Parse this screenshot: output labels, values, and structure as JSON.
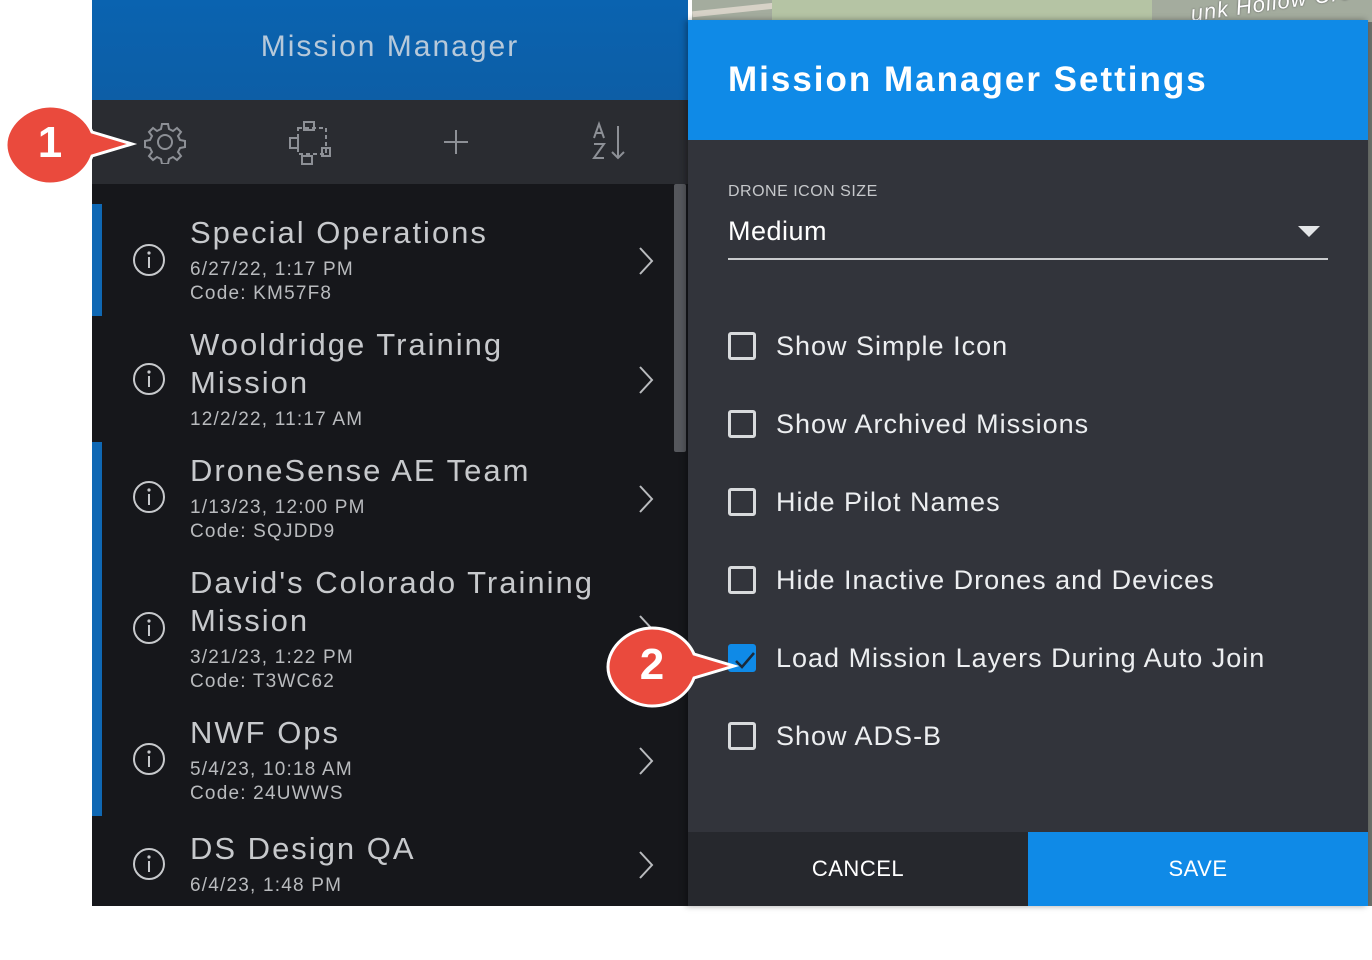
{
  "left_panel": {
    "title": "Mission Manager",
    "toolbar": {
      "settings_icon": "gear-icon",
      "layers_icon": "frame-select-icon",
      "add_icon": "plus-icon",
      "sort_icon": "sort-az-icon"
    },
    "missions": [
      {
        "name_lines": [
          "Special Operations"
        ],
        "date": "6/27/22, 1:17 PM",
        "code": "Code: KM57F8",
        "active": true
      },
      {
        "name_lines": [
          "Wooldridge Training",
          "Mission"
        ],
        "date": "12/2/22, 11:17 AM",
        "code": "",
        "active": false
      },
      {
        "name_lines": [
          "DroneSense AE Team"
        ],
        "date": "1/13/23, 12:00 PM",
        "code": "Code: SQJDD9",
        "active": true
      },
      {
        "name_lines": [
          "David's Colorado Training",
          "Mission"
        ],
        "date": "3/21/23, 1:22 PM",
        "code": "Code: T3WC62",
        "active": true
      },
      {
        "name_lines": [
          "NWF Ops"
        ],
        "date": "5/4/23, 10:18 AM",
        "code": "Code: 24UWWS",
        "active": true
      },
      {
        "name_lines": [
          "DS Design QA"
        ],
        "date": "6/4/23, 1:48 PM",
        "code": "",
        "active": false
      }
    ]
  },
  "map": {
    "label": "unk Hollow Cre"
  },
  "settings": {
    "title": "Mission Manager Settings",
    "drone_icon_size": {
      "label": "DRONE ICON SIZE",
      "value": "Medium"
    },
    "options": [
      {
        "label": "Show Simple Icon",
        "checked": false
      },
      {
        "label": "Show Archived Missions",
        "checked": false
      },
      {
        "label": "Hide Pilot Names",
        "checked": false
      },
      {
        "label": "Hide Inactive Drones and Devices",
        "checked": false
      },
      {
        "label": "Load Mission Layers During Auto Join",
        "checked": true
      },
      {
        "label": "Show ADS-B",
        "checked": false
      }
    ],
    "cancel_label": "CANCEL",
    "save_label": "SAVE"
  },
  "callouts": [
    {
      "number": "1",
      "target": "settings gear"
    },
    {
      "number": "2",
      "target": "load mission layers checkbox"
    }
  ],
  "colors": {
    "accent": "#0f8ae7",
    "callout_red": "#ea4a3d",
    "panel_dark": "#16171b",
    "dialog_bg": "#32343b"
  }
}
